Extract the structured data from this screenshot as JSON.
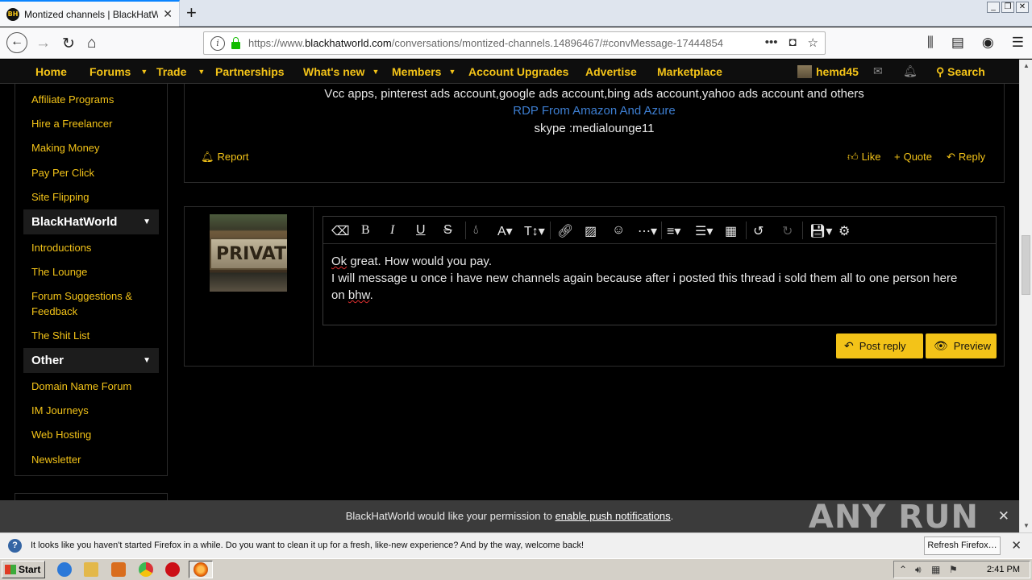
{
  "browser": {
    "tab_title": "Montized channels | BlackHatWorld",
    "favicon_text": "BH",
    "new_tab": "+",
    "url_scheme_host": "https://www.",
    "url_domain": "blackhatworld.com",
    "url_path": "/conversations/montized-channels.14896467/#convMessage-17444854",
    "url_more": "•••"
  },
  "forum_nav": {
    "items": [
      {
        "label": "Home"
      },
      {
        "label": "Forums"
      },
      {
        "label": "Trade"
      },
      {
        "label": "Partnerships"
      },
      {
        "label": "What's new"
      },
      {
        "label": "Members"
      },
      {
        "label": "Account Upgrades"
      },
      {
        "label": "Advertise"
      },
      {
        "label": "Marketplace"
      }
    ],
    "username": "hemd45",
    "search_label": "Search"
  },
  "sidebar": {
    "links_top": [
      "Affiliate Programs",
      "Hire a Freelancer",
      "Making Money",
      "Pay Per Click",
      "Site Flipping"
    ],
    "section_blackhat": "BlackHatWorld",
    "links_bhw": [
      "Introductions",
      "The Lounge",
      "Forum Suggestions &",
      "Feedback",
      "The Shit List"
    ],
    "section_other": "Other",
    "links_other": [
      "Domain Name Forum",
      "IM Journeys",
      "Web Hosting",
      "Newsletter"
    ]
  },
  "post": {
    "sig_line1": "Vcc apps, pinterest ads account,google ads account,bing ads account,yahoo ads account and others",
    "sig_link": "RDP From Amazon And Azure",
    "sig_line3": "skype :medialounge11",
    "report": "Report",
    "like": "Like",
    "quote": "Quote",
    "reply": "Reply"
  },
  "reply": {
    "avatar_text": "PRIVAT",
    "line1_a": "Ok",
    "line1_b": " great. How would you pay.",
    "line2": "I will message u once i have new channels again because after i posted this thread i sold them all to one person here",
    "line3_a": "on ",
    "line3_b": "bhw",
    "line3_c": ".",
    "post_reply": "Post reply",
    "preview": "Preview"
  },
  "push": {
    "text": "BlackHatWorld would like your permission to ",
    "link": "enable push notifications",
    "end": ".",
    "watermark": "ANY RUN"
  },
  "firefox_bar": {
    "text": "It looks like you haven't started Firefox in a while. Do you want to clean it up for a fresh, like-new experience? And by the way, welcome back!",
    "button": "Refresh Firefox…"
  },
  "taskbar": {
    "start": "Start",
    "time": "2:41 PM"
  }
}
